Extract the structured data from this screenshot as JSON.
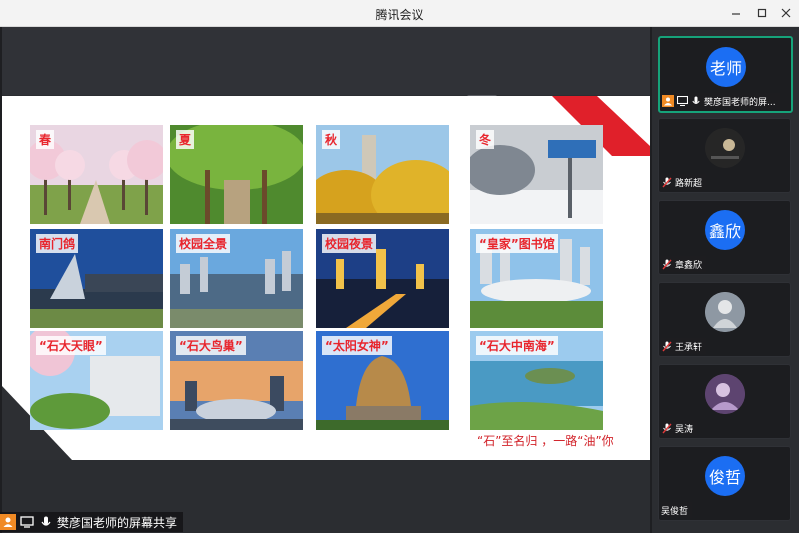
{
  "window": {
    "title": "腾讯会议"
  },
  "slide": {
    "tiles": [
      {
        "caption": "春",
        "icon": "spring-cherry-photo"
      },
      {
        "caption": "夏",
        "icon": "summer-tree-tunnel-photo"
      },
      {
        "caption": "秋",
        "icon": "autumn-campus-photo"
      },
      {
        "caption": "冬",
        "icon": "winter-snow-sign-photo"
      },
      {
        "caption": "南门鸽",
        "icon": "south-gate-photo"
      },
      {
        "caption": "校园全景",
        "icon": "campus-panorama-photo"
      },
      {
        "caption": "校园夜景",
        "icon": "campus-night-photo"
      },
      {
        "caption": "“皇家”图书馆",
        "icon": "library-photo"
      },
      {
        "caption": "“石大天眼”",
        "icon": "building-blossom-photo"
      },
      {
        "caption": "“石大鸟巢”",
        "icon": "stadium-sunset-photo"
      },
      {
        "caption": "“太阳女神”",
        "icon": "sun-goddess-sculpture-photo"
      },
      {
        "caption": "“石大中南海”",
        "icon": "lake-island-photo"
      }
    ],
    "slogan": "“石”至名归 ，一路“油”你"
  },
  "share_status": {
    "label": "樊彦国老师的屏幕共享"
  },
  "participants": [
    {
      "name": "樊彦国老师的屏...",
      "avatar_text": "老师",
      "avatar_type": "blue",
      "active": true
    },
    {
      "name": "路新超",
      "avatar_text": "",
      "avatar_type": "photo-dark"
    },
    {
      "name": "章鑫欣",
      "avatar_text": "鑫欣",
      "avatar_type": "blue"
    },
    {
      "name": "王承轩",
      "avatar_text": "",
      "avatar_type": "photo-gray"
    },
    {
      "name": "吴涛",
      "avatar_text": "",
      "avatar_type": "photo-purple"
    },
    {
      "name": "吴俊哲",
      "avatar_text": "俊哲",
      "avatar_type": "blue"
    }
  ],
  "colors": {
    "accent_blue": "#1b6ef3",
    "active_border": "#16a37a",
    "caption_red": "#e8252d",
    "host_orange": "#f08a24"
  }
}
